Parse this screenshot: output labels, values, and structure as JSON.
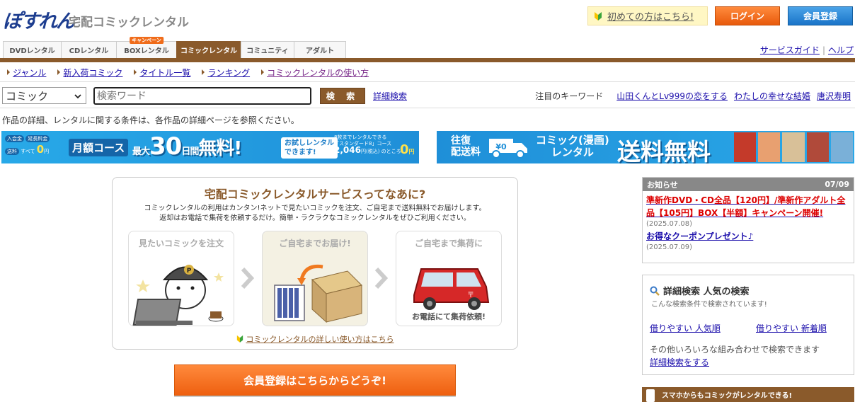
{
  "header": {
    "logo": "ぽすれん",
    "subtitle": "宅配コミックレンタル",
    "beginner_link": "初めての方はこちら!",
    "login_button": "ログイン",
    "register_button": "会員登録"
  },
  "tabs": [
    {
      "label": "DVDレンタル"
    },
    {
      "label": "CDレンタル"
    },
    {
      "label": "BOXレンタル",
      "badge": "キャンペーン"
    },
    {
      "label": "コミックレンタル",
      "active": true
    },
    {
      "label": "コミュニティ"
    },
    {
      "label": "アダルト"
    }
  ],
  "top_links": {
    "guide": "サービスガイド",
    "help": "ヘルプ"
  },
  "subnav": [
    "ジャンル",
    "新入荷コミック",
    "タイトル一覧",
    "ランキング",
    "コミックレンタルの使い方"
  ],
  "search": {
    "category": "コミック",
    "placeholder": "検索ワード",
    "button": "検 索",
    "advanced": "詳細検索"
  },
  "keywords": {
    "label": "注目のキーワード",
    "items": [
      "山田くんとLv999の恋をする",
      "わたしの幸せな結婚",
      "唐沢寿明"
    ]
  },
  "notice": "作品の詳細、レンタルに関する条件は、各作品の詳細ページを参照ください。",
  "banner1": {
    "fee1": "入会金",
    "fee2": "延長料金",
    "fee3": "送料",
    "all": "すべて",
    "zero": "0",
    "unit": "円",
    "plan": "月額コース",
    "max": "最大",
    "days": "30",
    "days_unit": "日間",
    "free": "無料!",
    "try": "お試しレンタル",
    "try2": "できます!",
    "std1": "8枚までレンタルできる",
    "std2": "「スタンダード8」コース",
    "std3": "2,046",
    "std4": "円(税込)",
    "std5": "のところ"
  },
  "banner2": {
    "round": "往復",
    "round2": "配送料",
    "label1": "コミック(漫画)",
    "label2": "レンタル",
    "big": "送料無料"
  },
  "mainbox": {
    "title": "宅配コミックレンタルサービスってなあに?",
    "desc1": "コミックレンタルの利用はカンタン!ネットで見たいコミックを注文、ご自宅まで送料無料でお届けします。",
    "desc2": "返却はお電話で集荷を依頼するだけ。簡単・ラクラクなコミックレンタルをぜひご利用ください。",
    "steps": [
      {
        "title": "見たいコミックを注文"
      },
      {
        "title": "ご自宅までお届け!"
      },
      {
        "title": "ご自宅まで集荷に",
        "caption": "お電話にて集荷依頼!"
      }
    ],
    "howto": "コミックレンタルの詳しい使い方はこちら"
  },
  "cta": "会員登録はこちらからどうぞ!",
  "news": {
    "label": "お知らせ",
    "date": "07/09",
    "items": [
      {
        "text": "準新作DVD・CD全品【120円】/準新作アダルト全品【105円】BOX【半額】キャンペーン開催!",
        "date": "(2025.07.08)"
      },
      {
        "text": "お得なクーポンプレゼント♪",
        "date": "(2025.07.09)"
      }
    ]
  },
  "popular": {
    "title": "詳細検索 人気の検索",
    "subtitle": "こんな検索条件で検索されています!",
    "link1": "借りやすい 人気順",
    "link2": "借りやすい 新着順",
    "other": "その他いろいろな組み合わせで検索できます",
    "adv": "詳細検索をする"
  },
  "sp_banner": "スマホからもコミックがレンタルできる!",
  "colors": {
    "brown": "#8a5a2b",
    "orange": "#f06c1a",
    "blue": "#1a74c8",
    "link": "#1a0dab"
  }
}
